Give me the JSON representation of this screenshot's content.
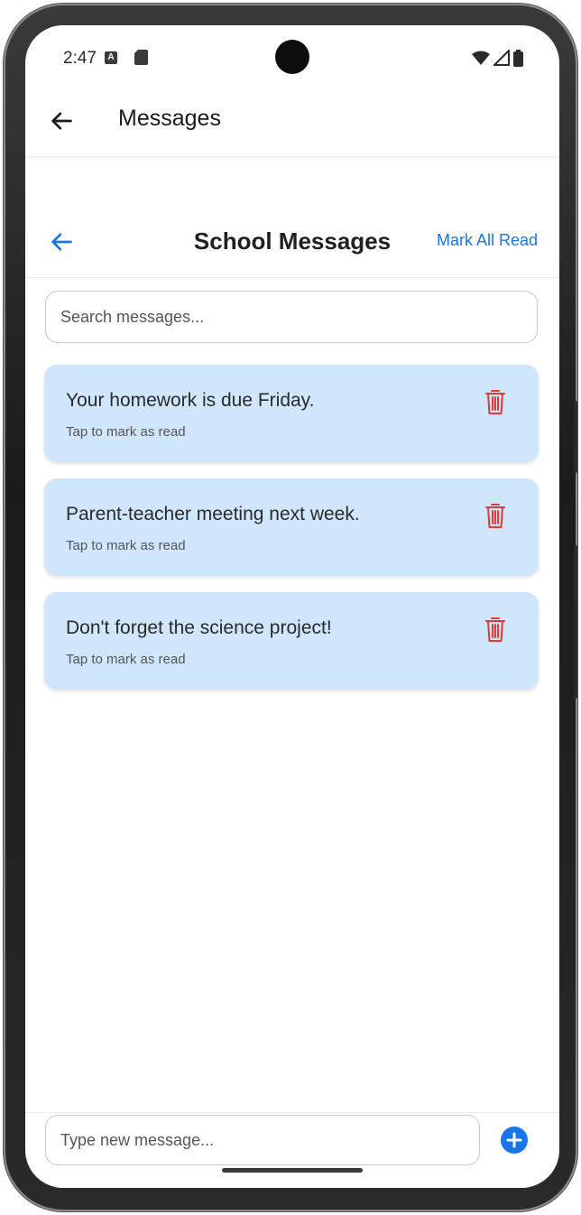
{
  "status_bar": {
    "time": "2:47",
    "notification_icon": "A"
  },
  "app_bar": {
    "title": "Messages"
  },
  "sub_header": {
    "title": "School Messages",
    "mark_all_label": "Mark All Read"
  },
  "search": {
    "placeholder": "Search messages..."
  },
  "messages": [
    {
      "text": "Your homework is due Friday.",
      "hint": "Tap to mark as read"
    },
    {
      "text": "Parent-teacher meeting next week.",
      "hint": "Tap to mark as read"
    },
    {
      "text": "Don't forget the science project!",
      "hint": "Tap to mark as read"
    }
  ],
  "composer": {
    "placeholder": "Type new message..."
  },
  "colors": {
    "accent": "#1877e8",
    "card_bg": "#cfe6fc",
    "delete": "#e53935"
  },
  "icons": {
    "back": "arrow-left-icon",
    "delete": "trash-icon",
    "send": "plus-circle-icon"
  }
}
